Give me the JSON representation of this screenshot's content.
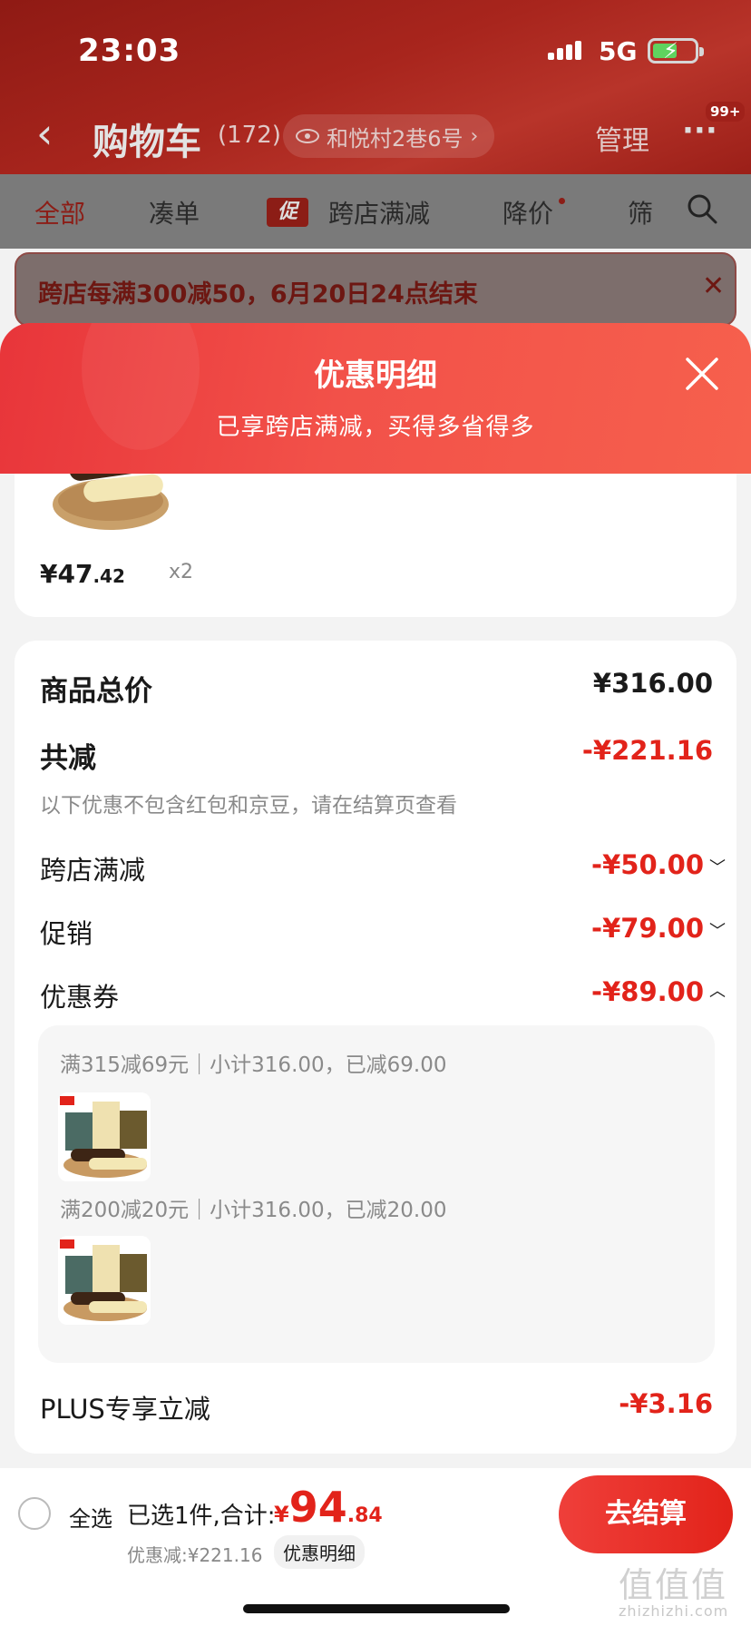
{
  "status_bar": {
    "time": "23:03",
    "network": "5G"
  },
  "navbar": {
    "title": "购物车",
    "count": "(172)",
    "address": "和悦村2巷6号",
    "manage": "管理",
    "more": "···",
    "badge": "99+"
  },
  "tabs": [
    "全部",
    "凑单",
    "跨店满减",
    "降价",
    "筛"
  ],
  "promo_tag": "促",
  "promo_banner": "跨店每满300减50，6月20日24点结束",
  "sheet": {
    "title": "优惠明细",
    "subtitle": "已享跨店满减，买得多省得多"
  },
  "product": {
    "price_int": "¥47",
    "price_dec": ".42",
    "qty": "x2"
  },
  "summary": {
    "total_label": "商品总价",
    "total_value": "¥316.00",
    "reduce_label": "共减",
    "reduce_value": "-¥221.16",
    "note": "以下优惠不包含红包和京豆，请在结算页查看",
    "rows": [
      {
        "label": "跨店满减",
        "value": "-¥50.00"
      },
      {
        "label": "促销",
        "value": "-¥79.00"
      },
      {
        "label": "优惠券",
        "value": "-¥89.00"
      }
    ],
    "coupons": [
      "满315减69元｜小计316.00，已减69.00",
      "满200减20元｜小计316.00，已减20.00"
    ],
    "plus_label": "PLUS专享立减",
    "plus_value": "-¥3.16"
  },
  "bottom": {
    "select_all": "全选",
    "selected": "已选1件,合计:",
    "yen": "¥",
    "total_int": "94",
    "total_dec": ".84",
    "discount": "优惠减:¥221.16",
    "detail": "优惠明细",
    "checkout": "去结算"
  },
  "watermark": "值值值",
  "watermark_sub": "zhizhizhi.com",
  "colors": {
    "accent": "#e2231a",
    "sheet_gradient_start": "#e8353a",
    "sheet_gradient_end": "#f6604d"
  }
}
